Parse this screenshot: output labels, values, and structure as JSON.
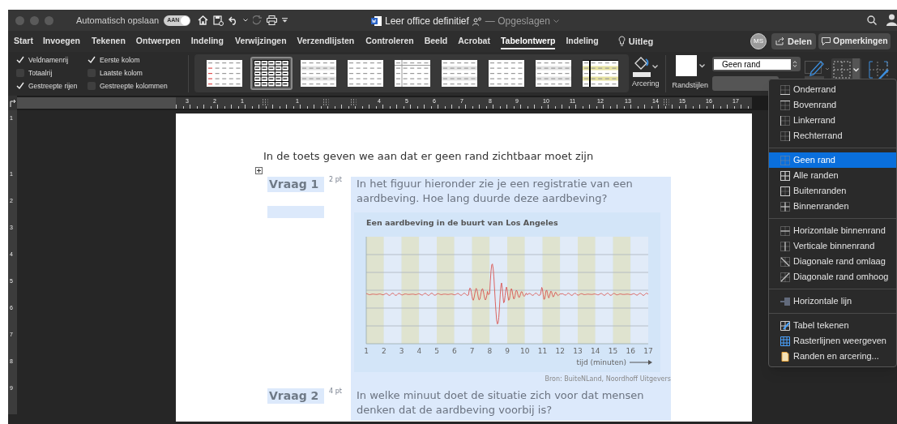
{
  "title_bar": {
    "autosave_label": "Automatisch opslaan",
    "autosave_toggle": {
      "label": "AAN",
      "on": true
    },
    "document_title": "Leer office definitief",
    "save_status": "— Opgeslagen"
  },
  "ribbon_tabs": [
    {
      "label": "Start",
      "selected": false
    },
    {
      "label": "Invoegen",
      "selected": false
    },
    {
      "label": "Tekenen",
      "selected": false
    },
    {
      "label": "Ontwerpen",
      "selected": false
    },
    {
      "label": "Indeling",
      "selected": false
    },
    {
      "label": "Verwijzingen",
      "selected": false
    },
    {
      "label": "Verzendlijsten",
      "selected": false
    },
    {
      "label": "Controleren",
      "selected": false
    },
    {
      "label": "Beeld",
      "selected": false
    },
    {
      "label": "Acrobat",
      "selected": false
    },
    {
      "label": "Tabelontwerp",
      "selected": true
    },
    {
      "label": "Indeling",
      "selected": false
    }
  ],
  "tell_me": "Uitleg",
  "avatar": "MS",
  "share_button": "Delen",
  "comments_button": "Opmerkingen",
  "style_options": [
    {
      "label": "Veldnamenrij",
      "checked": true
    },
    {
      "label": "Totaalrij",
      "checked": false
    },
    {
      "label": "Gestreepte rijen",
      "checked": true
    },
    {
      "label": "Eerste kolom",
      "checked": true
    },
    {
      "label": "Laatste kolom",
      "checked": false
    },
    {
      "label": "Gestreepte kolommen",
      "checked": false
    }
  ],
  "table_styles": [
    {
      "selected": false
    },
    {
      "selected": true
    },
    {
      "selected": false
    },
    {
      "selected": false
    },
    {
      "selected": false
    },
    {
      "selected": false
    },
    {
      "selected": false
    },
    {
      "selected": false
    },
    {
      "selected": false
    }
  ],
  "shading_label": "Arcering",
  "border_styles_label": "Randstijlen",
  "border_combo": "Geen rand",
  "border_menu": [
    [
      {
        "label": "Onderrand",
        "selected": false
      },
      {
        "label": "Bovenrand",
        "selected": false
      },
      {
        "label": "Linkerrand",
        "selected": false
      },
      {
        "label": "Rechterrand",
        "selected": false
      }
    ],
    [
      {
        "label": "Geen rand",
        "selected": true
      },
      {
        "label": "Alle randen",
        "selected": false
      },
      {
        "label": "Buitenranden",
        "selected": false
      },
      {
        "label": "Binnenranden",
        "selected": false
      }
    ],
    [
      {
        "label": "Horizontale binnenrand",
        "selected": false
      },
      {
        "label": "Verticale binnenrand",
        "selected": false
      },
      {
        "label": "Diagonale rand omlaag",
        "selected": false
      },
      {
        "label": "Diagonale rand omhoog",
        "selected": false
      }
    ],
    [
      {
        "label": "Horizontale lijn",
        "selected": false
      }
    ],
    [
      {
        "label": "Tabel tekenen",
        "selected": false
      },
      {
        "label": "Rasterlijnen weergeven",
        "selected": false
      },
      {
        "label": "Randen en arcering...",
        "selected": false
      }
    ]
  ],
  "ruler": {
    "horizontal": [
      "3",
      "2",
      "1",
      "1",
      "4",
      "5",
      "6",
      "7",
      "8",
      "9",
      "10",
      "11",
      "12",
      "13",
      "14",
      "15",
      "16",
      "17"
    ],
    "vertical": [
      "1",
      "1",
      "2",
      "3",
      "4",
      "5",
      "6",
      "7",
      "8",
      "9"
    ]
  },
  "document": {
    "intro": "In de toets geven we aan dat er geen rand zichtbaar moet zijn",
    "questions": [
      {
        "label": "Vraag 1",
        "points": "2 pt",
        "text": "In het figuur hieronder zie je een registratie van een aardbeving. Hoe lang duurde deze aardbeving?"
      },
      {
        "label": "Vraag 2",
        "points": "4 pt",
        "text": "In welke minuut doet de situatie zich voor dat mensen denken dat de aardbeving voorbij is?"
      }
    ],
    "figure": {
      "title": "Een aardbeving in de buurt van Los Angeles",
      "x_ticks": [
        "1",
        "2",
        "3",
        "4",
        "5",
        "6",
        "7",
        "8",
        "9",
        "10",
        "11",
        "12",
        "13",
        "14",
        "15",
        "16",
        "17"
      ],
      "xlabel": "tijd (minuten)",
      "source": "Bron: BuiteNLand, Noordhoff Uitgevers"
    }
  }
}
